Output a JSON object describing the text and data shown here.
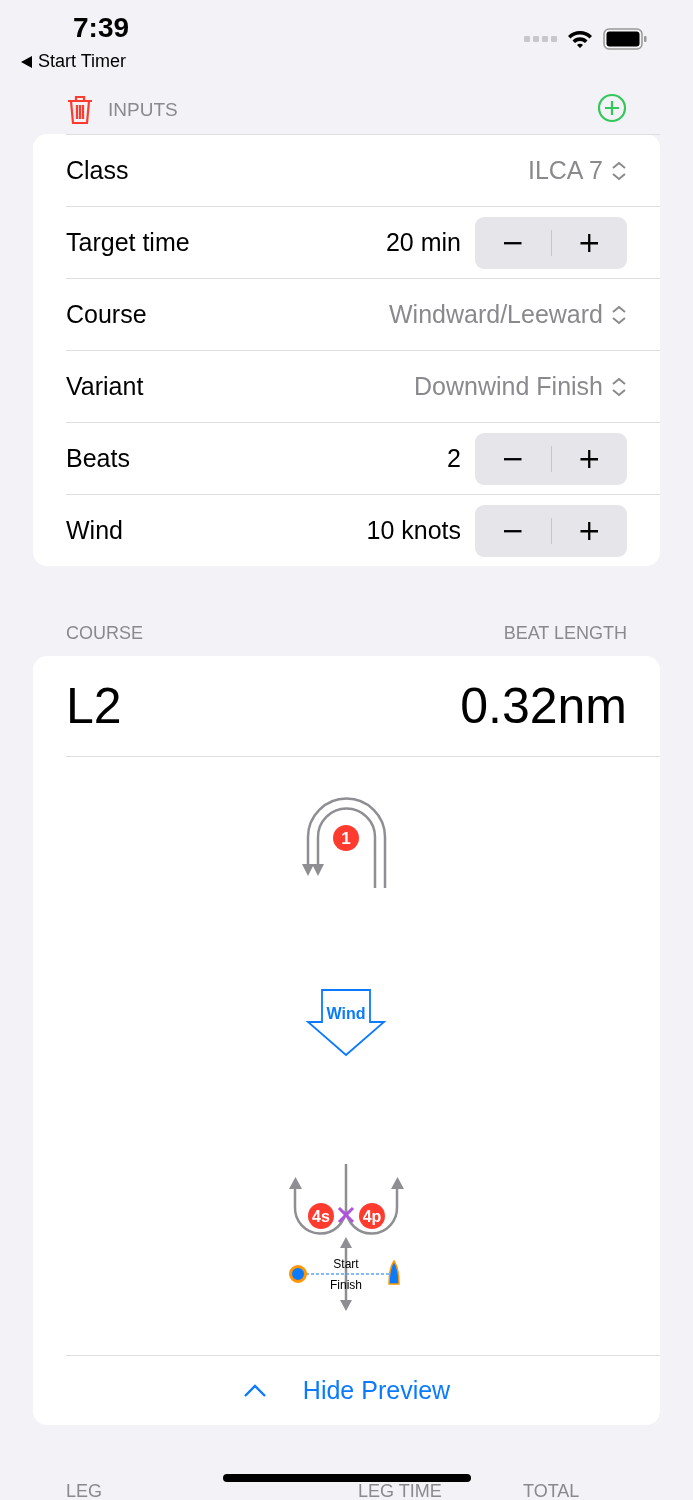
{
  "status_bar": {
    "time": "7:39",
    "back": "Start Timer"
  },
  "inputs": {
    "header": "INPUTS",
    "rows": [
      {
        "kind": "picker",
        "label": "Class",
        "value": "ILCA 7"
      },
      {
        "kind": "stepper",
        "label": "Target time",
        "value": "20 min",
        "minus": "−",
        "plus": "+"
      },
      {
        "kind": "picker",
        "label": "Course",
        "value": "Windward/Leeward"
      },
      {
        "kind": "picker",
        "label": "Variant",
        "value": "Downwind Finish"
      },
      {
        "kind": "stepper",
        "label": "Beats",
        "value": "2",
        "minus": "−",
        "plus": "+"
      },
      {
        "kind": "stepper",
        "label": "Wind",
        "value": "10 knots",
        "minus": "−",
        "plus": "+"
      }
    ]
  },
  "course": {
    "header_left": "COURSE",
    "header_right": "BEAT LENGTH",
    "name": "L2",
    "beat_length": "0.32nm",
    "diagram": {
      "top_mark": "1",
      "wind": "Wind",
      "gate_left": "4s",
      "gate_right": "4p",
      "start": "Start",
      "finish": "Finish"
    },
    "toggle": "Hide Preview"
  },
  "legs": {
    "columns": [
      "LEG",
      "LEG TIME",
      "TOTAL"
    ]
  }
}
